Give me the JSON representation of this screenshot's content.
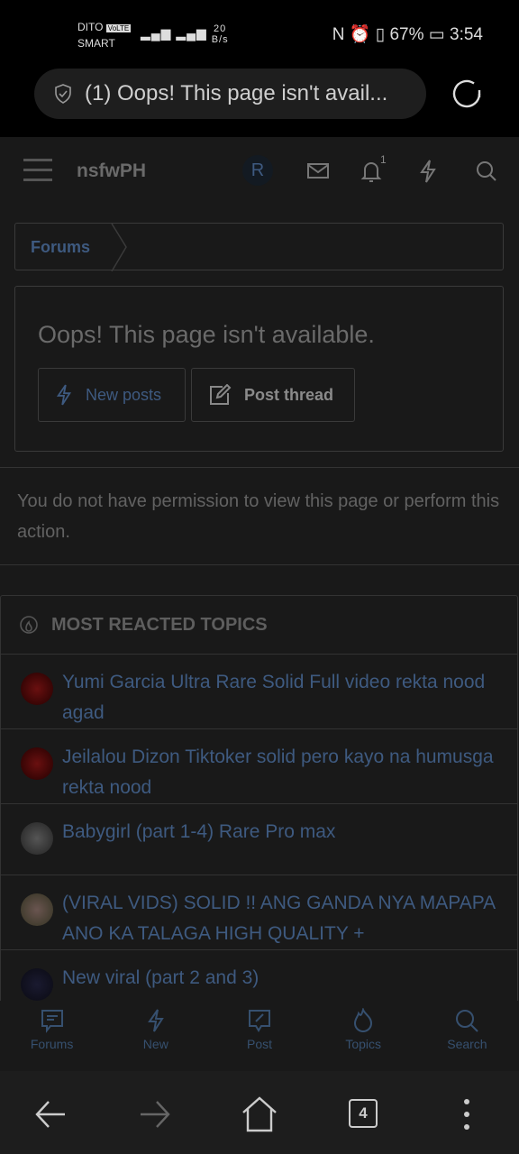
{
  "status_bar": {
    "carrier1": "DITO",
    "volte": "VoLTE",
    "carrier2": "SMART",
    "speed_value": "20",
    "speed_unit": "B/s",
    "battery": "67%",
    "time": "3:54"
  },
  "browser": {
    "url_title": "(1) Oops! This page isn't avail...",
    "tab_count": "4"
  },
  "header": {
    "brand": "nsfwPH",
    "avatar_letter": "R",
    "notification_count": "1"
  },
  "breadcrumb": {
    "item": "Forums"
  },
  "page": {
    "title": "Oops! This page isn't available.",
    "new_posts": "New posts",
    "post_thread": "Post thread",
    "message": "You do not have permission to view this page or perform this action."
  },
  "topics": {
    "heading": "MOST REACTED TOPICS",
    "items": [
      {
        "title": "Yumi Garcia Ultra Rare Solid Full video rekta nood agad"
      },
      {
        "title": "Jeilalou Dizon Tiktoker solid pero kayo na humusga rekta nood"
      },
      {
        "title": "Babygirl (part 1-4) Rare Pro max"
      },
      {
        "title": "(VIRAL VIDS) SOLID !! ANG GANDA NYA MAPAPA ANO KA TALAGA HIGH QUALITY +"
      },
      {
        "title": "New viral (part 2 and 3)"
      }
    ]
  },
  "bottom_nav": [
    {
      "label": "Forums"
    },
    {
      "label": "New"
    },
    {
      "label": "Post"
    },
    {
      "label": "Topics"
    },
    {
      "label": "Search"
    }
  ],
  "colors": {
    "link": "#3e5a80",
    "border": "#3a3a3a",
    "background": "#191919"
  }
}
